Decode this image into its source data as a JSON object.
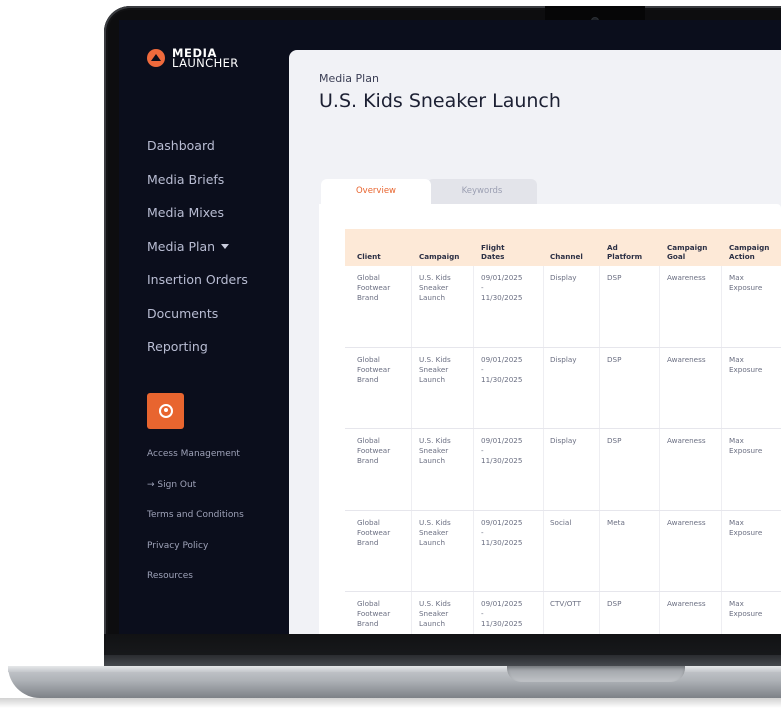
{
  "brand": {
    "line1": "MEDIA",
    "line2": "LAUNCHER"
  },
  "sidebar": {
    "nav": [
      {
        "label": "Dashboard"
      },
      {
        "label": "Media Briefs"
      },
      {
        "label": "Media Mixes"
      },
      {
        "label": "Media Plan",
        "has_caret": true
      },
      {
        "label": "Insertion Orders"
      },
      {
        "label": "Documents"
      },
      {
        "label": "Reporting"
      }
    ],
    "footer": [
      {
        "label": "Access Management"
      },
      {
        "label": "→ Sign Out"
      },
      {
        "label": "Terms and Conditions"
      },
      {
        "label": "Privacy Policy"
      },
      {
        "label": "Resources"
      }
    ]
  },
  "page": {
    "section": "Media Plan",
    "title": "U.S. Kids Sneaker Launch"
  },
  "tabs": [
    {
      "label": "Overview",
      "active": true
    },
    {
      "label": "Keywords",
      "active": false
    }
  ],
  "table": {
    "columns": [
      {
        "key": "client",
        "label": "Client"
      },
      {
        "key": "campaign",
        "label": "Campaign"
      },
      {
        "key": "flight",
        "label": "Flight\nDates"
      },
      {
        "key": "channel",
        "label": "Channel"
      },
      {
        "key": "platform",
        "label": "Ad\nPlatform"
      },
      {
        "key": "goal",
        "label": "Campaign\nGoal"
      },
      {
        "key": "action",
        "label": "Campaign\nAction"
      }
    ],
    "rows": [
      {
        "client": "Global\nFootwear\nBrand",
        "campaign": "U.S. Kids\nSneaker\nLaunch",
        "flight": "09/01/2025\n-\n11/30/2025",
        "channel": "Display",
        "platform": "DSP",
        "goal": "Awareness",
        "action": "Max\nExposure"
      },
      {
        "client": "Global\nFootwear\nBrand",
        "campaign": "U.S. Kids\nSneaker\nLaunch",
        "flight": "09/01/2025\n-\n11/30/2025",
        "channel": "Display",
        "platform": "DSP",
        "goal": "Awareness",
        "action": "Max\nExposure"
      },
      {
        "client": "Global\nFootwear\nBrand",
        "campaign": "U.S. Kids\nSneaker\nLaunch",
        "flight": "09/01/2025\n-\n11/30/2025",
        "channel": "Display",
        "platform": "DSP",
        "goal": "Awareness",
        "action": "Max\nExposure"
      },
      {
        "client": "Global\nFootwear\nBrand",
        "campaign": "U.S. Kids\nSneaker\nLaunch",
        "flight": "09/01/2025\n-\n11/30/2025",
        "channel": "Social",
        "platform": "Meta",
        "goal": "Awareness",
        "action": "Max\nExposure"
      },
      {
        "client": "Global\nFootwear\nBrand",
        "campaign": "U.S. Kids\nSneaker\nLaunch",
        "flight": "09/01/2025\n-\n11/30/2025",
        "channel": "CTV/OTT",
        "platform": "DSP",
        "goal": "Awareness",
        "action": "Max\nExposure"
      }
    ]
  },
  "colors": {
    "sidebar_bg": "#0b0e1c",
    "accent": "#e8652f",
    "table_header_bg": "#fde9d7",
    "main_bg": "#f1f2f6"
  }
}
